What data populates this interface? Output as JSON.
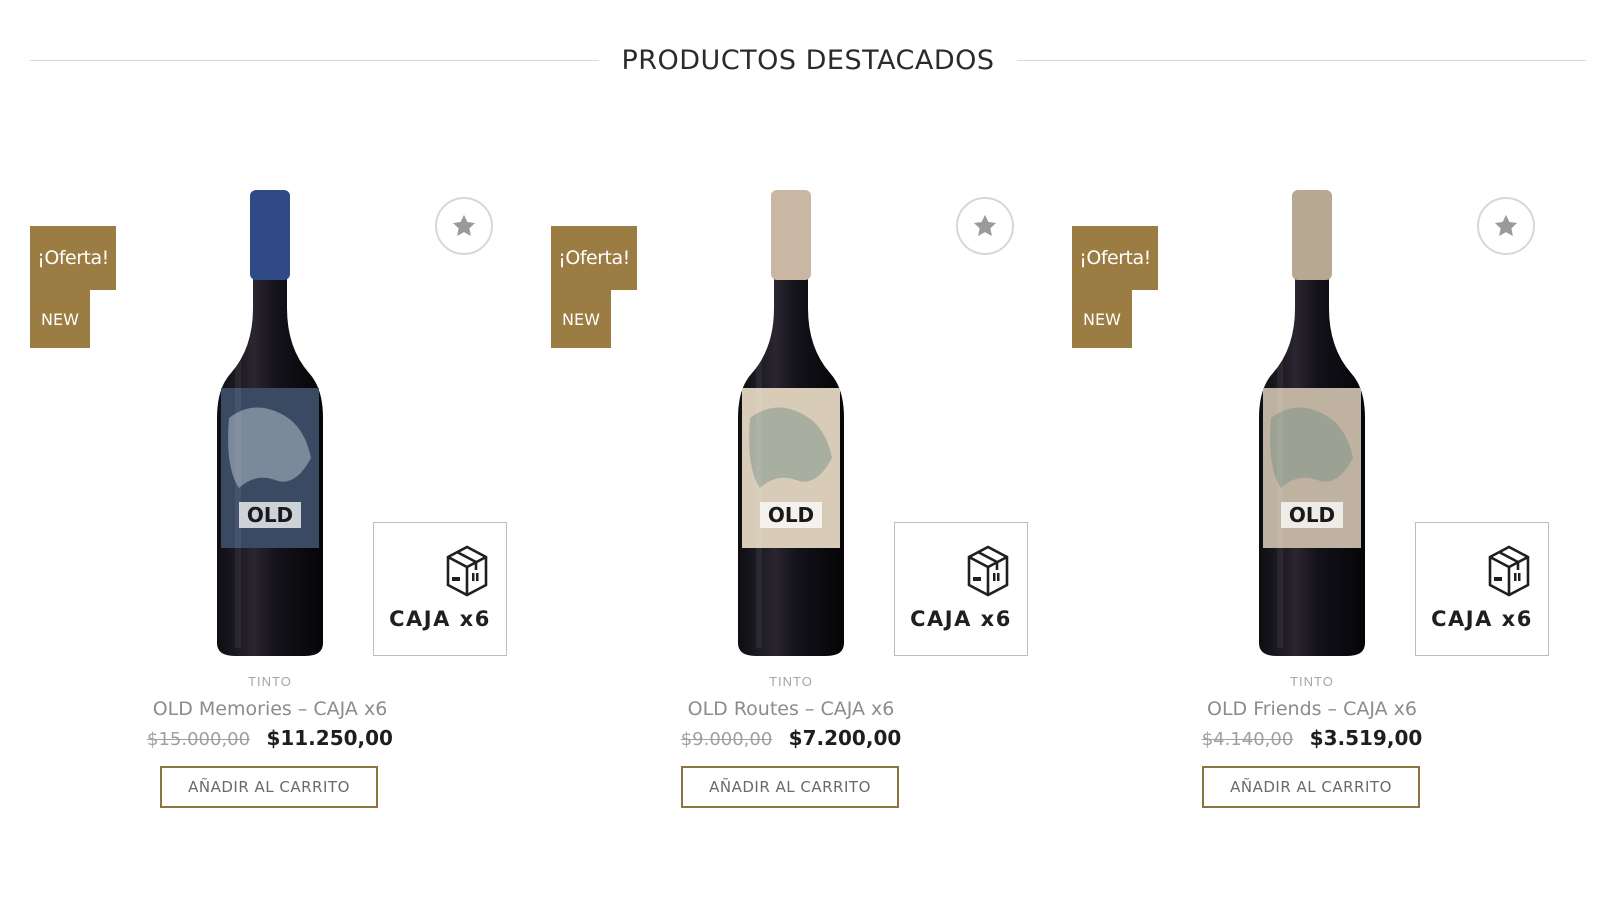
{
  "section": {
    "title": "PRODUCTOS DESTACADOS"
  },
  "colors": {
    "badge": "#9b7c43",
    "button_border": "#8c7440"
  },
  "products": [
    {
      "badge_sale": "¡Oferta!",
      "badge_new": "NEW",
      "box_label": "CAJA x6",
      "category": "TINTO",
      "title": "OLD Memories – CAJA x6",
      "old_price": "$15.000,00",
      "price": "$11.250,00",
      "button_label": "AÑADIR AL CARRITO",
      "favorite_icon": "star-icon",
      "box_icon": "package-icon",
      "bottle_label_color": "#3a4a63",
      "bottle_cap_color": "#2f4a86",
      "label_text": "OLD"
    },
    {
      "badge_sale": "¡Oferta!",
      "badge_new": "NEW",
      "box_label": "CAJA x6",
      "category": "TINTO",
      "title": "OLD Routes – CAJA x6",
      "old_price": "$9.000,00",
      "price": "$7.200,00",
      "button_label": "AÑADIR AL CARRITO",
      "favorite_icon": "star-icon",
      "box_icon": "package-icon",
      "bottle_label_color": "#d8cbb8",
      "bottle_cap_color": "#c9b7a3",
      "label_text": "OLD"
    },
    {
      "badge_sale": "¡Oferta!",
      "badge_new": "NEW",
      "box_label": "CAJA x6",
      "category": "TINTO",
      "title": "OLD Friends – CAJA x6",
      "old_price": "$4.140,00",
      "price": "$3.519,00",
      "button_label": "AÑADIR AL CARRITO",
      "favorite_icon": "star-icon",
      "box_icon": "package-icon",
      "bottle_label_color": "#bfb2a0",
      "bottle_cap_color": "#b7a892",
      "label_text": "OLD"
    }
  ]
}
